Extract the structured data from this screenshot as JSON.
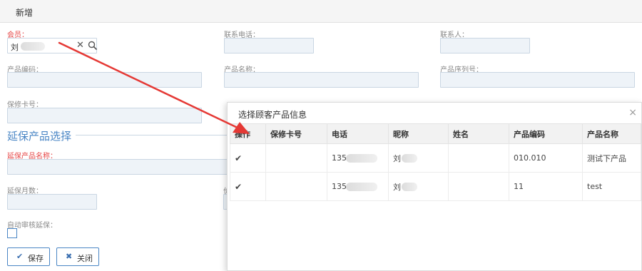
{
  "window": {
    "title": "新增"
  },
  "form": {
    "member": {
      "label": "会员：",
      "value": "刘"
    },
    "phone": {
      "label": "联系电话："
    },
    "contact": {
      "label": "联系人："
    },
    "product_code": {
      "label": "产品编码："
    },
    "product_name": {
      "label": "产品名称："
    },
    "product_serial": {
      "label": "产品序列号："
    },
    "warranty_card": {
      "label": "保修卡号："
    },
    "section_title": "延保产品选择",
    "ext_product_name": {
      "label": "延保产品名称："
    },
    "ext_months": {
      "label": "延保月数："
    },
    "ext_price_partial": "价",
    "auto_review": {
      "label": "自动审核延保：",
      "checked": false
    }
  },
  "buttons": {
    "save": {
      "label": "保存",
      "icon": "check-icon"
    },
    "close": {
      "label": "关闭",
      "icon": "close-icon"
    }
  },
  "modal": {
    "title": "选择顾客产品信息",
    "close_glyph": "×",
    "columns": [
      "操作",
      "保修卡号",
      "电话",
      "昵称",
      "姓名",
      "产品编码",
      "产品名称"
    ],
    "rows": [
      {
        "action": "✔",
        "warranty": "",
        "phone": "135",
        "nickname": "刘",
        "name": "",
        "code": "010.010",
        "product": "测试下产品"
      },
      {
        "action": "✔",
        "warranty": "",
        "phone": "135",
        "nickname": "刘",
        "name": "",
        "code": "11",
        "product": "test"
      }
    ]
  },
  "colors": {
    "required_label": "#e64545",
    "accent": "#4a86c5",
    "annotation_arrow": "#e53935"
  }
}
